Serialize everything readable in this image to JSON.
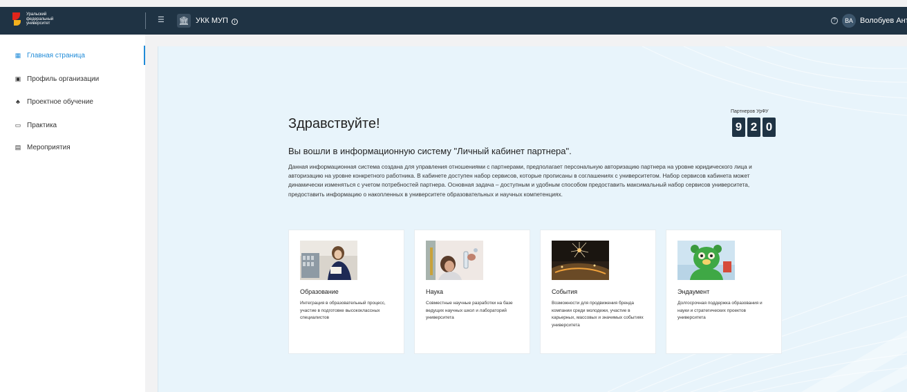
{
  "header": {
    "logo_lines": [
      "Уральский",
      "федеральный",
      "университет"
    ],
    "org_name": "УКК МУП",
    "avatar_initials": "ВА",
    "user_name": "Волобуев Анто"
  },
  "sidebar": {
    "items": [
      {
        "label": "Главная страница",
        "icon": "dashboard-grid-icon",
        "active": true
      },
      {
        "label": "Профиль организации",
        "icon": "profile-card-icon",
        "active": false
      },
      {
        "label": "Проектное обучение",
        "icon": "project-icon",
        "active": false
      },
      {
        "label": "Практика",
        "icon": "practice-id-icon",
        "active": false
      },
      {
        "label": "Мероприятия",
        "icon": "calendar-icon",
        "active": false
      }
    ]
  },
  "main": {
    "greeting": "Здравствуйте!",
    "partners_label": "Партнеров УрФУ",
    "partners_digits": [
      "9",
      "2",
      "0"
    ],
    "subtitle": "Вы вошли в информационную систему \"Личный кабинет партнера\".",
    "description": "Данная информационная система создана для управления отношениями с партнерами, предполагает персональную авторизацию партнера на уровне юридического лица и авторизацию на уровне конкретного работника. В кабинете доступен набор сервисов, которые прописаны в соглашениях с университетом. Набор сервисов кабинета может динамически изменяться с учетом потребностей партнера. Основная задача – доступным и удобным способом предоставить максимальный набор сервисов университета, предоставить информацию о накопленных в университете образовательных и научных компетенциях.",
    "cards": [
      {
        "title": "Образование",
        "text": "Интеграция в образовательный процесс, участие в подготовке высококлассных специалистов"
      },
      {
        "title": "Наука",
        "text": "Совместные научные разработки на базе ведущих научных школ и лабораторий университета"
      },
      {
        "title": "События",
        "text": "Возможности для продвижения бренда компании среди молодежи, участие в карьерных, массовых и значимых событиях университета"
      },
      {
        "title": "Эндаумент",
        "text": "Долгосрочная поддержка образования и науки и стратегических проектов университета"
      }
    ]
  },
  "colors": {
    "topbar": "#1f3344",
    "accent": "#1f8bd8",
    "main_bg": "#e8f4fb"
  }
}
